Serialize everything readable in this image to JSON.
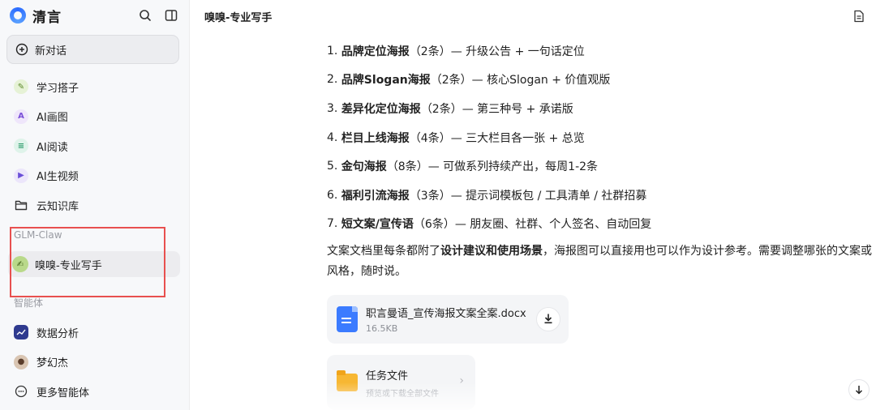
{
  "app": {
    "name": "清言"
  },
  "sidebar": {
    "new_chat_label": "新对话",
    "nav": [
      {
        "label": "学习搭子",
        "icon": "study-buddy-icon",
        "color": "#e6f2d6"
      },
      {
        "label": "AI画图",
        "icon": "ai-drawing-icon",
        "color": "#efe6fb"
      },
      {
        "label": "AI阅读",
        "icon": "ai-reading-icon",
        "color": "#dff3ea"
      },
      {
        "label": "AI生视频",
        "icon": "ai-video-icon",
        "color": "#ece6fb"
      },
      {
        "label": "云知识库",
        "icon": "folder-icon",
        "color": "#f7f8fa"
      }
    ],
    "section_claw": "GLM-Claw",
    "claw_item": "嗅嗅-专业写手",
    "section_agents": "智能体",
    "agents": [
      {
        "label": "数据分析",
        "icon": "data-analysis-icon"
      },
      {
        "label": "梦幻杰",
        "icon": "avatar-icon"
      },
      {
        "label": "更多智能体",
        "icon": "more-agents-icon"
      }
    ]
  },
  "header": {
    "title": "嗅嗅-专业写手"
  },
  "content": {
    "items": [
      {
        "num": "1.",
        "title": "品牌定位海报",
        "rest": "（2条）— 升级公告 + 一句话定位"
      },
      {
        "num": "2.",
        "title": "品牌Slogan海报",
        "rest": "（2条）— 核心Slogan + 价值观版"
      },
      {
        "num": "3.",
        "title": "差异化定位海报",
        "rest": "（2条）— 第三种号 + 承诺版"
      },
      {
        "num": "4.",
        "title": "栏目上线海报",
        "rest": "（4条）— 三大栏目各一张 + 总览"
      },
      {
        "num": "5.",
        "title": "金句海报",
        "rest": "（8条）— 可做系列持续产出，每周1-2条"
      },
      {
        "num": "6.",
        "title": "福利引流海报",
        "rest": "（3条）— 提示词模板包 / 工具清单 / 社群招募"
      },
      {
        "num": "7.",
        "title": "短文案/宣传语",
        "rest": "（6条）— 朋友圈、社群、个人签名、自动回复"
      }
    ],
    "para_a": "文案文档里每条都附了",
    "para_b": "设计建议和使用场景",
    "para_c": "，海报图可以直接用也可以作为设计参考。需要调整哪张的文案或风格，随时说。"
  },
  "file": {
    "name": "职言曼语_宣传海报文案全案.docx",
    "size": "16.5KB"
  },
  "task": {
    "title": "任务文件",
    "subtitle": "预览或下载全部文件"
  }
}
